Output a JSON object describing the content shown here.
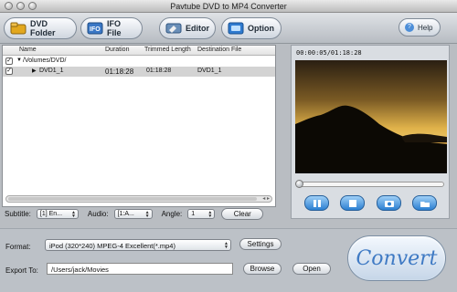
{
  "app": {
    "title": "Pavtube DVD to MP4 Converter"
  },
  "toolbar": {
    "dvd_folder": "DVD Folder",
    "ifo_file": "IFO File",
    "editor": "Editor",
    "option": "Option",
    "help": "Help"
  },
  "file_list": {
    "columns": [
      "Name",
      "Duration",
      "Trimmed Length",
      "Destination File"
    ],
    "folder": "/Volumes/DVD/",
    "rows": [
      {
        "name": "DVD1_1",
        "duration": "01:18:28",
        "trimmed": "01:18:28",
        "destination": "DVD1_1",
        "checked": true
      }
    ],
    "scroll_arrows": "◂ ▸"
  },
  "options_bar": {
    "subtitle_label": "Subtitle:",
    "subtitle_value": "[1] En...",
    "audio_label": "Audio:",
    "audio_value": "[1:A...",
    "angle_label": "Angle:",
    "angle_value": "1",
    "clear": "Clear"
  },
  "preview": {
    "timecode": "00:00:05/01:18:28",
    "seek_progress": 0.0
  },
  "output": {
    "format_label": "Format:",
    "format_value": "iPod (320*240) MPEG-4 Excellent(*.mp4)",
    "settings": "Settings",
    "export_label": "Export To:",
    "export_path": "/Users/jack/Movies",
    "browse": "Browse",
    "open": "Open",
    "convert": "Convert"
  },
  "colors": {
    "accent": "#3f7ac4",
    "control_blue": "#2b7fd1"
  }
}
